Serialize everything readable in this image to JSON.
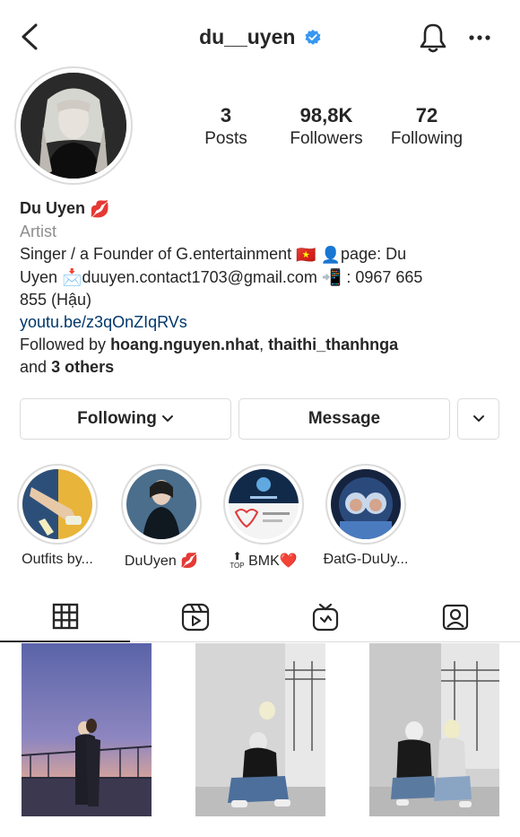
{
  "header": {
    "username": "du__uyen",
    "verified_color": "#3897f0"
  },
  "stats": [
    {
      "value": "3",
      "label": "Posts"
    },
    {
      "value": "98,8K",
      "label": "Followers"
    },
    {
      "value": "72",
      "label": "Following"
    }
  ],
  "bio": {
    "name": "Du Uyen",
    "name_emoji": "💋",
    "category": "Artist",
    "line1_text": "Singer / a Founder of G.entertainment",
    "line1_flag": "🇻🇳",
    "line1_person": "👤",
    "line1_page": "page: Du",
    "line2_uyen": "Uyen",
    "line2_envelope": "📩",
    "line2_email": "duuyen.contact1703@gmail.com",
    "line2_phone_emoji": "📲",
    "line2_phone": ": 0967 665",
    "line3": "855 (Hậu)",
    "link": "youtu.be/z3qOnZIqRVs",
    "followed_prefix": "Followed by",
    "follower1": "hoang.nguyen.nhat",
    "comma": ",",
    "follower2": "thaithi_thanhnga",
    "and_text": "and",
    "others": "3 others"
  },
  "buttons": {
    "following": "Following",
    "message": "Message"
  },
  "highlights": [
    {
      "caption": "Outfits by..."
    },
    {
      "caption": "DuUyen 💋"
    },
    {
      "caption": "BMK❤️",
      "prefix": "⬆",
      "prefix_sub": "TOP"
    },
    {
      "caption": "ĐatG-DuUy..."
    }
  ],
  "colors": {
    "text": "#262626",
    "secondary": "#8e8e8e",
    "link": "#00376b",
    "border": "#dbdbdb"
  },
  "icons": {
    "back": "chevron-left-icon",
    "bell": "bell-icon",
    "more": "more-horizontal-icon",
    "grid": "grid-icon",
    "reels": "reels-icon",
    "igtv": "igtv-icon",
    "tagged": "tagged-icon"
  }
}
